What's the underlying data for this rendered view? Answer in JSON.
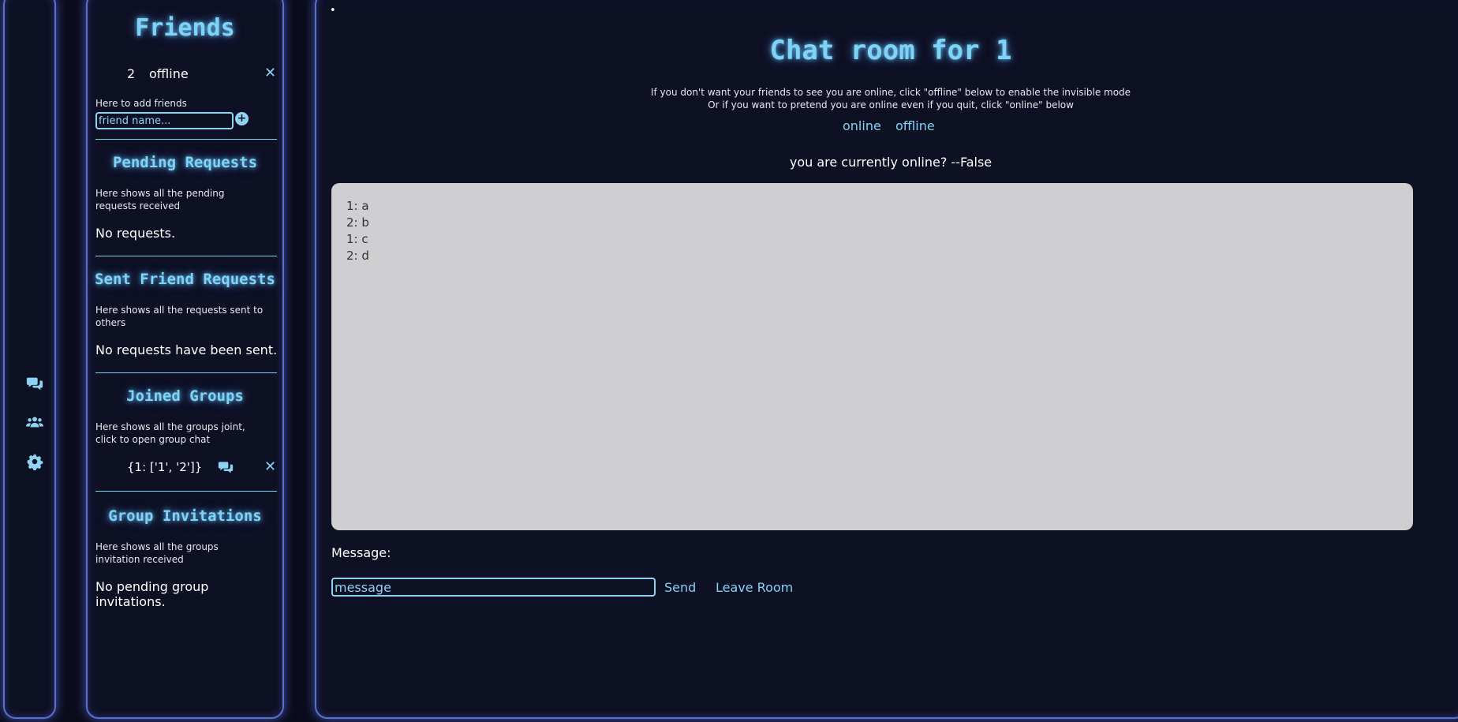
{
  "icon_rail": {
    "icons": [
      {
        "name": "chat-icon"
      },
      {
        "name": "users-icon"
      },
      {
        "name": "gear-icon"
      }
    ]
  },
  "friends_panel": {
    "title": "Friends",
    "friend": {
      "id": "2",
      "status": "offline"
    },
    "add_hint": "Here to add friends",
    "add_placeholder": "friend name...",
    "add_button": "+",
    "pending": {
      "title": "Pending Requests",
      "desc": "Here shows all the pending requests received",
      "empty": "No requests."
    },
    "sent": {
      "title": "Sent Friend Requests",
      "desc": "Here shows all the requests sent to others",
      "empty": "No requests have been sent."
    },
    "groups": {
      "title": "Joined Groups",
      "desc": "Here shows all the groups joint, click to open group chat",
      "item": "{1: ['1', '2']}"
    },
    "invites": {
      "title": "Group Invitations",
      "desc": "Here shows all the groups invitation received",
      "empty": "No pending group invitations."
    }
  },
  "main": {
    "bullet": "•",
    "title": "Chat room for 1",
    "info_line1": "If you don't want your friends to see you are online, click \"offline\" below to enable the invisible mode",
    "info_line2": "Or if you want to pretend you are online even if you quit, click \"online\" below",
    "online_label": "online",
    "offline_label": "offline",
    "status": "you are currently online? --False",
    "messages": [
      "1: a",
      "2: b",
      "1: c",
      "2: d"
    ],
    "message_label": "Message:",
    "message_placeholder": "message",
    "send_label": "Send",
    "leave_label": "Leave Room"
  },
  "colors": {
    "accent": "#7fd4f5",
    "background": "#0a0b1a",
    "panel": "#0e1024",
    "border": "#5a6fd0",
    "chat_box": "#cfcfd2"
  }
}
